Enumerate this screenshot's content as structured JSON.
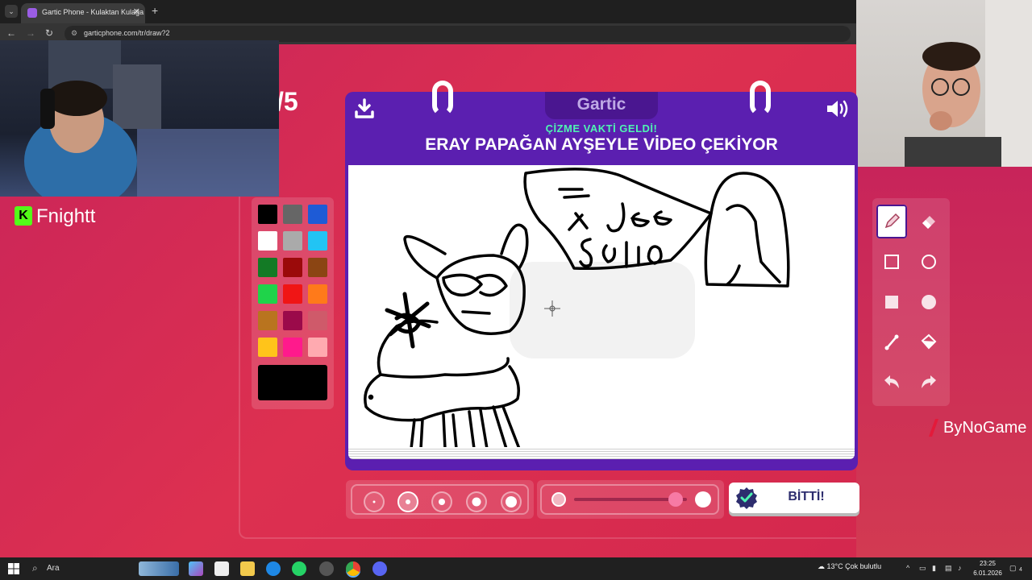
{
  "browser": {
    "tab_title": "Gartic Phone - Kulaktan Kulağa",
    "url": "garticphone.com/tr/draw?2"
  },
  "game": {
    "round_counter": "/5",
    "logo": "Gartic",
    "subtitle": "ÇİZME VAKTİ GELDİ!",
    "prompt": "ERAY PAPAĞAN AYŞEYLE VİDEO ÇEKİYOR",
    "done_label": "BİTTİ!",
    "selected_brush_size_index": 1,
    "opacity_level": 0.9
  },
  "palette": {
    "colors": [
      "#000000",
      "#666666",
      "#1e5bd6",
      "#ffffff",
      "#aaaaaa",
      "#22c4f4",
      "#137a25",
      "#9b0a0a",
      "#8b4513",
      "#1fd34a",
      "#f01515",
      "#ff7a1a",
      "#b9741f",
      "#9b0a4a",
      "#cf5a6a",
      "#ffc41a",
      "#ff1a8c",
      "#ffaab0"
    ],
    "current_color": "#000000"
  },
  "tools": [
    "pencil-icon",
    "eraser-icon",
    "rectangle-outline-icon",
    "circle-outline-icon",
    "rectangle-fill-icon",
    "circle-fill-icon",
    "line-icon",
    "bucket-icon",
    "undo-icon",
    "redo-icon"
  ],
  "overlay": {
    "streamer_name": "Fnightt",
    "sponsor": "ByNoGame"
  },
  "taskbar": {
    "search_label": "Ara",
    "weather": "13°C  Çok bulutlu",
    "time": "23:25",
    "date": "6.01.2026",
    "notification_count": "4"
  }
}
